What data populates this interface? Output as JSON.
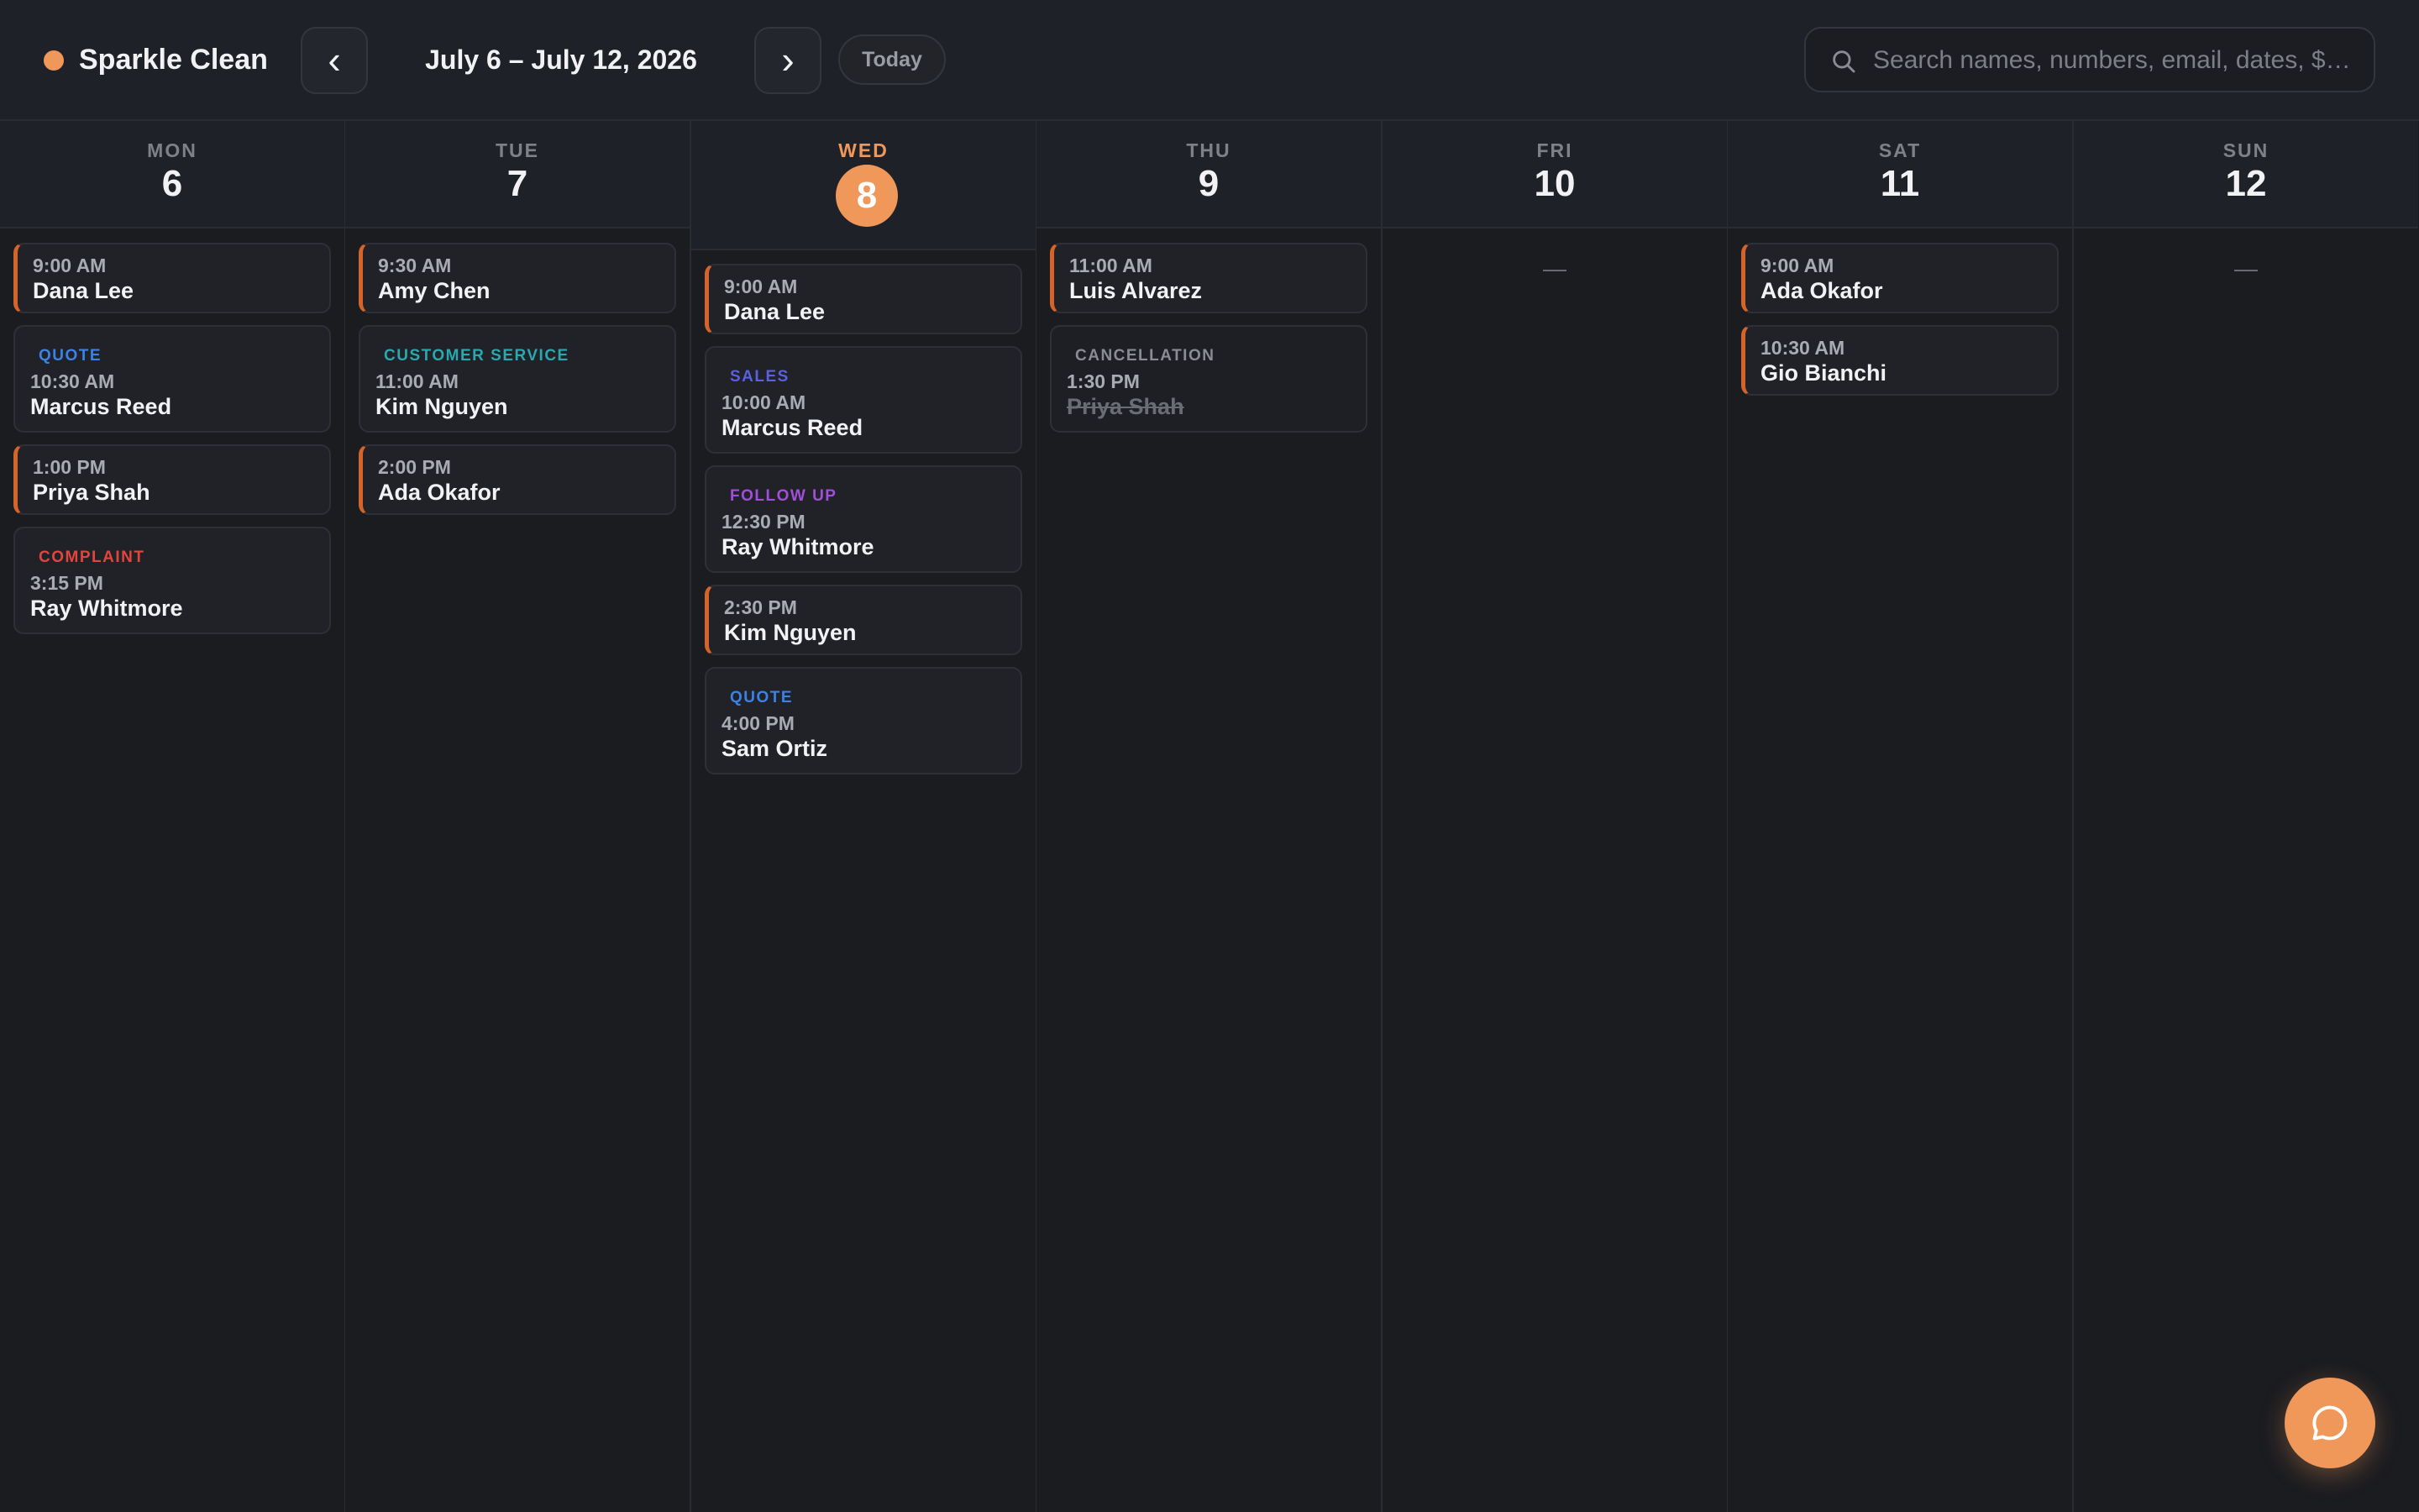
{
  "colors": {
    "accent": "#f0975a",
    "quote": "#3b82e8",
    "customer_service": "#2aa8b0",
    "sales": "#5b5fe0",
    "follow_up": "#a24fd8",
    "complaint": "#e0453e",
    "cancellation": "#8a8c94"
  },
  "header": {
    "brand": "Sparkle Clean",
    "prev_label": "‹",
    "next_label": "›",
    "range": "July 6 – July 12, 2026",
    "today_label": "Today",
    "search_placeholder": "Search names, numbers, email, dates, $…",
    "search_icon": "search-icon"
  },
  "days": [
    {
      "dow": "MON",
      "dom": "6",
      "today": false,
      "empty_label": "",
      "events": [
        {
          "tag": "",
          "time": "9:00 AM",
          "name": "Dana Lee"
        },
        {
          "tag": "QUOTE",
          "time": "10:30 AM",
          "name": "Marcus Reed"
        },
        {
          "tag": "",
          "time": "1:00 PM",
          "name": "Priya Shah"
        },
        {
          "tag": "COMPLAINT",
          "time": "3:15 PM",
          "name": "Ray Whitmore"
        }
      ]
    },
    {
      "dow": "TUE",
      "dom": "7",
      "today": false,
      "empty_label": "",
      "events": [
        {
          "tag": "",
          "time": "9:30 AM",
          "name": "Amy Chen"
        },
        {
          "tag": "CUSTOMER SERVICE",
          "time": "11:00 AM",
          "name": "Kim Nguyen"
        },
        {
          "tag": "",
          "time": "2:00 PM",
          "name": "Ada Okafor"
        }
      ]
    },
    {
      "dow": "WED",
      "dom": "8",
      "today": true,
      "empty_label": "",
      "events": [
        {
          "tag": "",
          "time": "9:00 AM",
          "name": "Dana Lee"
        },
        {
          "tag": "SALES",
          "time": "10:00 AM",
          "name": "Marcus Reed"
        },
        {
          "tag": "FOLLOW UP",
          "time": "12:30 PM",
          "name": "Ray Whitmore"
        },
        {
          "tag": "",
          "time": "2:30 PM",
          "name": "Kim Nguyen"
        },
        {
          "tag": "QUOTE",
          "time": "4:00 PM",
          "name": "Sam Ortiz"
        }
      ]
    },
    {
      "dow": "THU",
      "dom": "9",
      "today": false,
      "empty_label": "",
      "events": [
        {
          "tag": "",
          "time": "11:00 AM",
          "name": "Luis Alvarez"
        },
        {
          "tag": "CANCELLATION",
          "time": "1:30 PM",
          "name": "Priya Shah"
        }
      ]
    },
    {
      "dow": "FRI",
      "dom": "10",
      "today": false,
      "empty_label": "—",
      "events": []
    },
    {
      "dow": "SAT",
      "dom": "11",
      "today": false,
      "empty_label": "",
      "events": [
        {
          "tag": "",
          "time": "9:00 AM",
          "name": "Ada Okafor"
        },
        {
          "tag": "",
          "time": "10:30 AM",
          "name": "Gio Bianchi"
        }
      ]
    },
    {
      "dow": "SUN",
      "dom": "12",
      "today": false,
      "empty_label": "—",
      "events": []
    }
  ],
  "fab": {
    "icon": "chat-bubble-icon"
  }
}
